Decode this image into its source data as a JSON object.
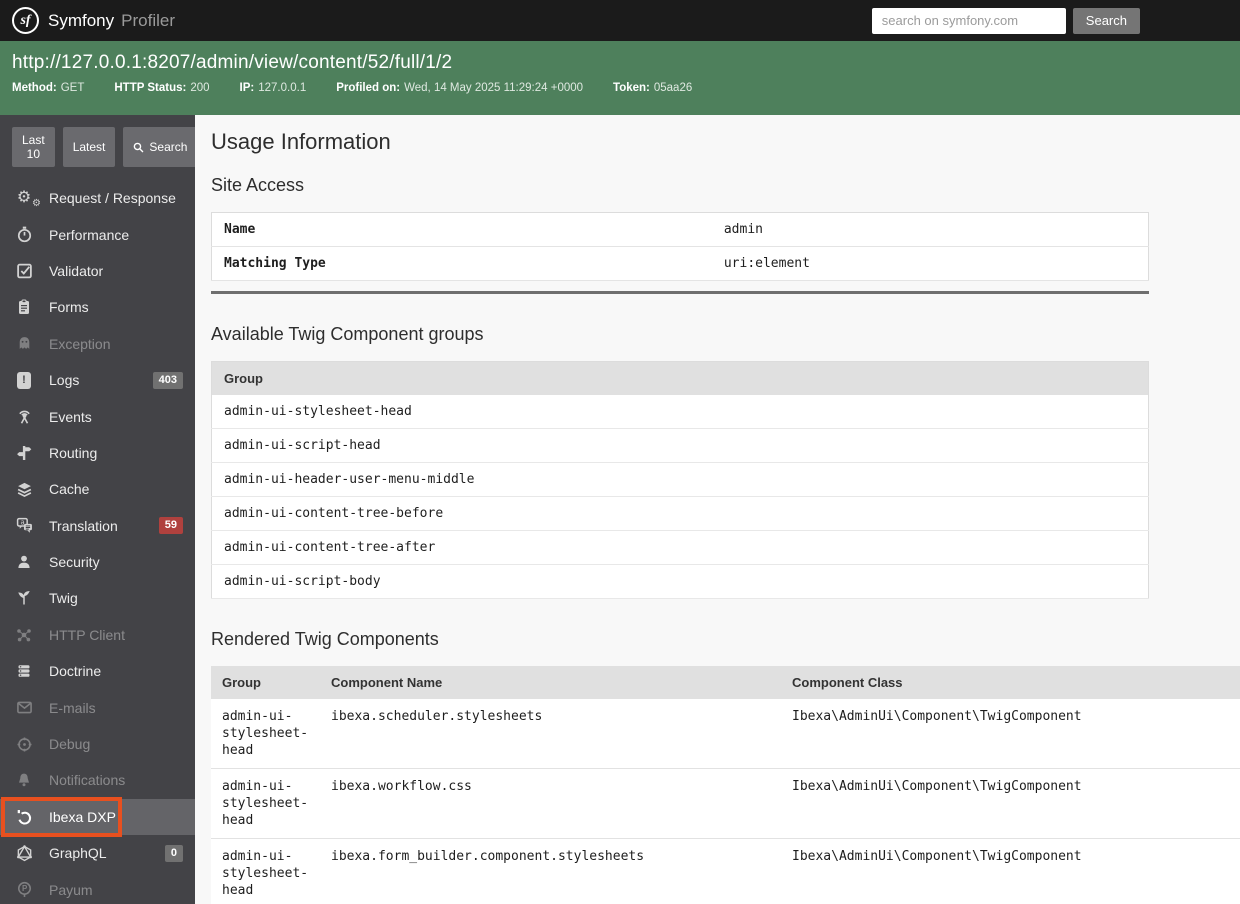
{
  "colors": {
    "accent_green": "#4e805c",
    "annotation_orange": "#e8501f",
    "badge_red": "#b0413e",
    "badge_gray": "#717171",
    "sidebar_bg": "#434347",
    "topbar_bg": "#1b1b1b"
  },
  "topbar": {
    "logo": "sf",
    "brand": "Symfony",
    "subtitle": "Profiler",
    "search_placeholder": "search on symfony.com",
    "search_button": "Search"
  },
  "request_bar": {
    "url": "http://127.0.0.1:8207/admin/view/content/52/full/1/2",
    "meta": [
      {
        "label": "Method:",
        "value": "GET"
      },
      {
        "label": "HTTP Status:",
        "value": "200"
      },
      {
        "label": "IP:",
        "value": "127.0.0.1"
      },
      {
        "label": "Profiled on:",
        "value": "Wed, 14 May 2025 11:29:24 +0000"
      },
      {
        "label": "Token:",
        "value": "05aa26"
      }
    ]
  },
  "sidebar": {
    "buttons": {
      "last10": "Last 10",
      "latest": "Latest",
      "search": "Search"
    },
    "items": [
      {
        "label": "Request / Response",
        "icon": "gears-icon",
        "state": "normal"
      },
      {
        "label": "Performance",
        "icon": "stopwatch-icon",
        "state": "normal"
      },
      {
        "label": "Validator",
        "icon": "check-square-icon",
        "state": "normal"
      },
      {
        "label": "Forms",
        "icon": "clipboard-icon",
        "state": "normal"
      },
      {
        "label": "Exception",
        "icon": "ghost-icon",
        "state": "disabled"
      },
      {
        "label": "Logs",
        "icon": "log-book-icon",
        "state": "normal",
        "badge": {
          "text": "403",
          "color": "#717171"
        }
      },
      {
        "label": "Events",
        "icon": "broadcast-icon",
        "state": "normal"
      },
      {
        "label": "Routing",
        "icon": "signpost-icon",
        "state": "normal"
      },
      {
        "label": "Cache",
        "icon": "layers-icon",
        "state": "normal"
      },
      {
        "label": "Translation",
        "icon": "translate-icon",
        "state": "normal",
        "badge": {
          "text": "59",
          "color": "#b0413e"
        }
      },
      {
        "label": "Security",
        "icon": "person-icon",
        "state": "normal"
      },
      {
        "label": "Twig",
        "icon": "twig-plant-icon",
        "state": "normal"
      },
      {
        "label": "HTTP Client",
        "icon": "network-icon",
        "state": "disabled"
      },
      {
        "label": "Doctrine",
        "icon": "database-icon",
        "state": "normal"
      },
      {
        "label": "E-mails",
        "icon": "envelope-icon",
        "state": "disabled"
      },
      {
        "label": "Debug",
        "icon": "target-icon",
        "state": "disabled"
      },
      {
        "label": "Notifications",
        "icon": "bell-icon",
        "state": "disabled"
      },
      {
        "label": "Ibexa DXP",
        "icon": "ibexa-logo-icon",
        "state": "selected",
        "annotated": true
      },
      {
        "label": "GraphQL",
        "icon": "graphql-icon",
        "state": "normal",
        "badge": {
          "text": "0",
          "color": "#717171"
        }
      },
      {
        "label": "Payum",
        "icon": "payum-pin-icon",
        "state": "disabled"
      }
    ]
  },
  "main": {
    "title": "Usage Information",
    "site_access": {
      "heading": "Site Access",
      "rows": [
        {
          "label": "Name",
          "value": "admin"
        },
        {
          "label": "Matching Type",
          "value": "uri:element"
        }
      ]
    },
    "groups": {
      "heading": "Available Twig Component groups",
      "column": "Group",
      "rows": [
        "admin-ui-stylesheet-head",
        "admin-ui-script-head",
        "admin-ui-header-user-menu-middle",
        "admin-ui-content-tree-before",
        "admin-ui-content-tree-after",
        "admin-ui-script-body"
      ]
    },
    "rendered": {
      "heading": "Rendered Twig Components",
      "columns": [
        "Group",
        "Component Name",
        "Component Class"
      ],
      "rows": [
        {
          "group": "admin-ui-stylesheet-head",
          "name": "ibexa.scheduler.stylesheets",
          "class": "Ibexa\\AdminUi\\Component\\TwigComponent"
        },
        {
          "group": "admin-ui-stylesheet-head",
          "name": "ibexa.workflow.css",
          "class": "Ibexa\\AdminUi\\Component\\TwigComponent"
        },
        {
          "group": "admin-ui-stylesheet-head",
          "name": "ibexa.form_builder.component.stylesheets",
          "class": "Ibexa\\AdminUi\\Component\\TwigComponent"
        }
      ]
    }
  }
}
